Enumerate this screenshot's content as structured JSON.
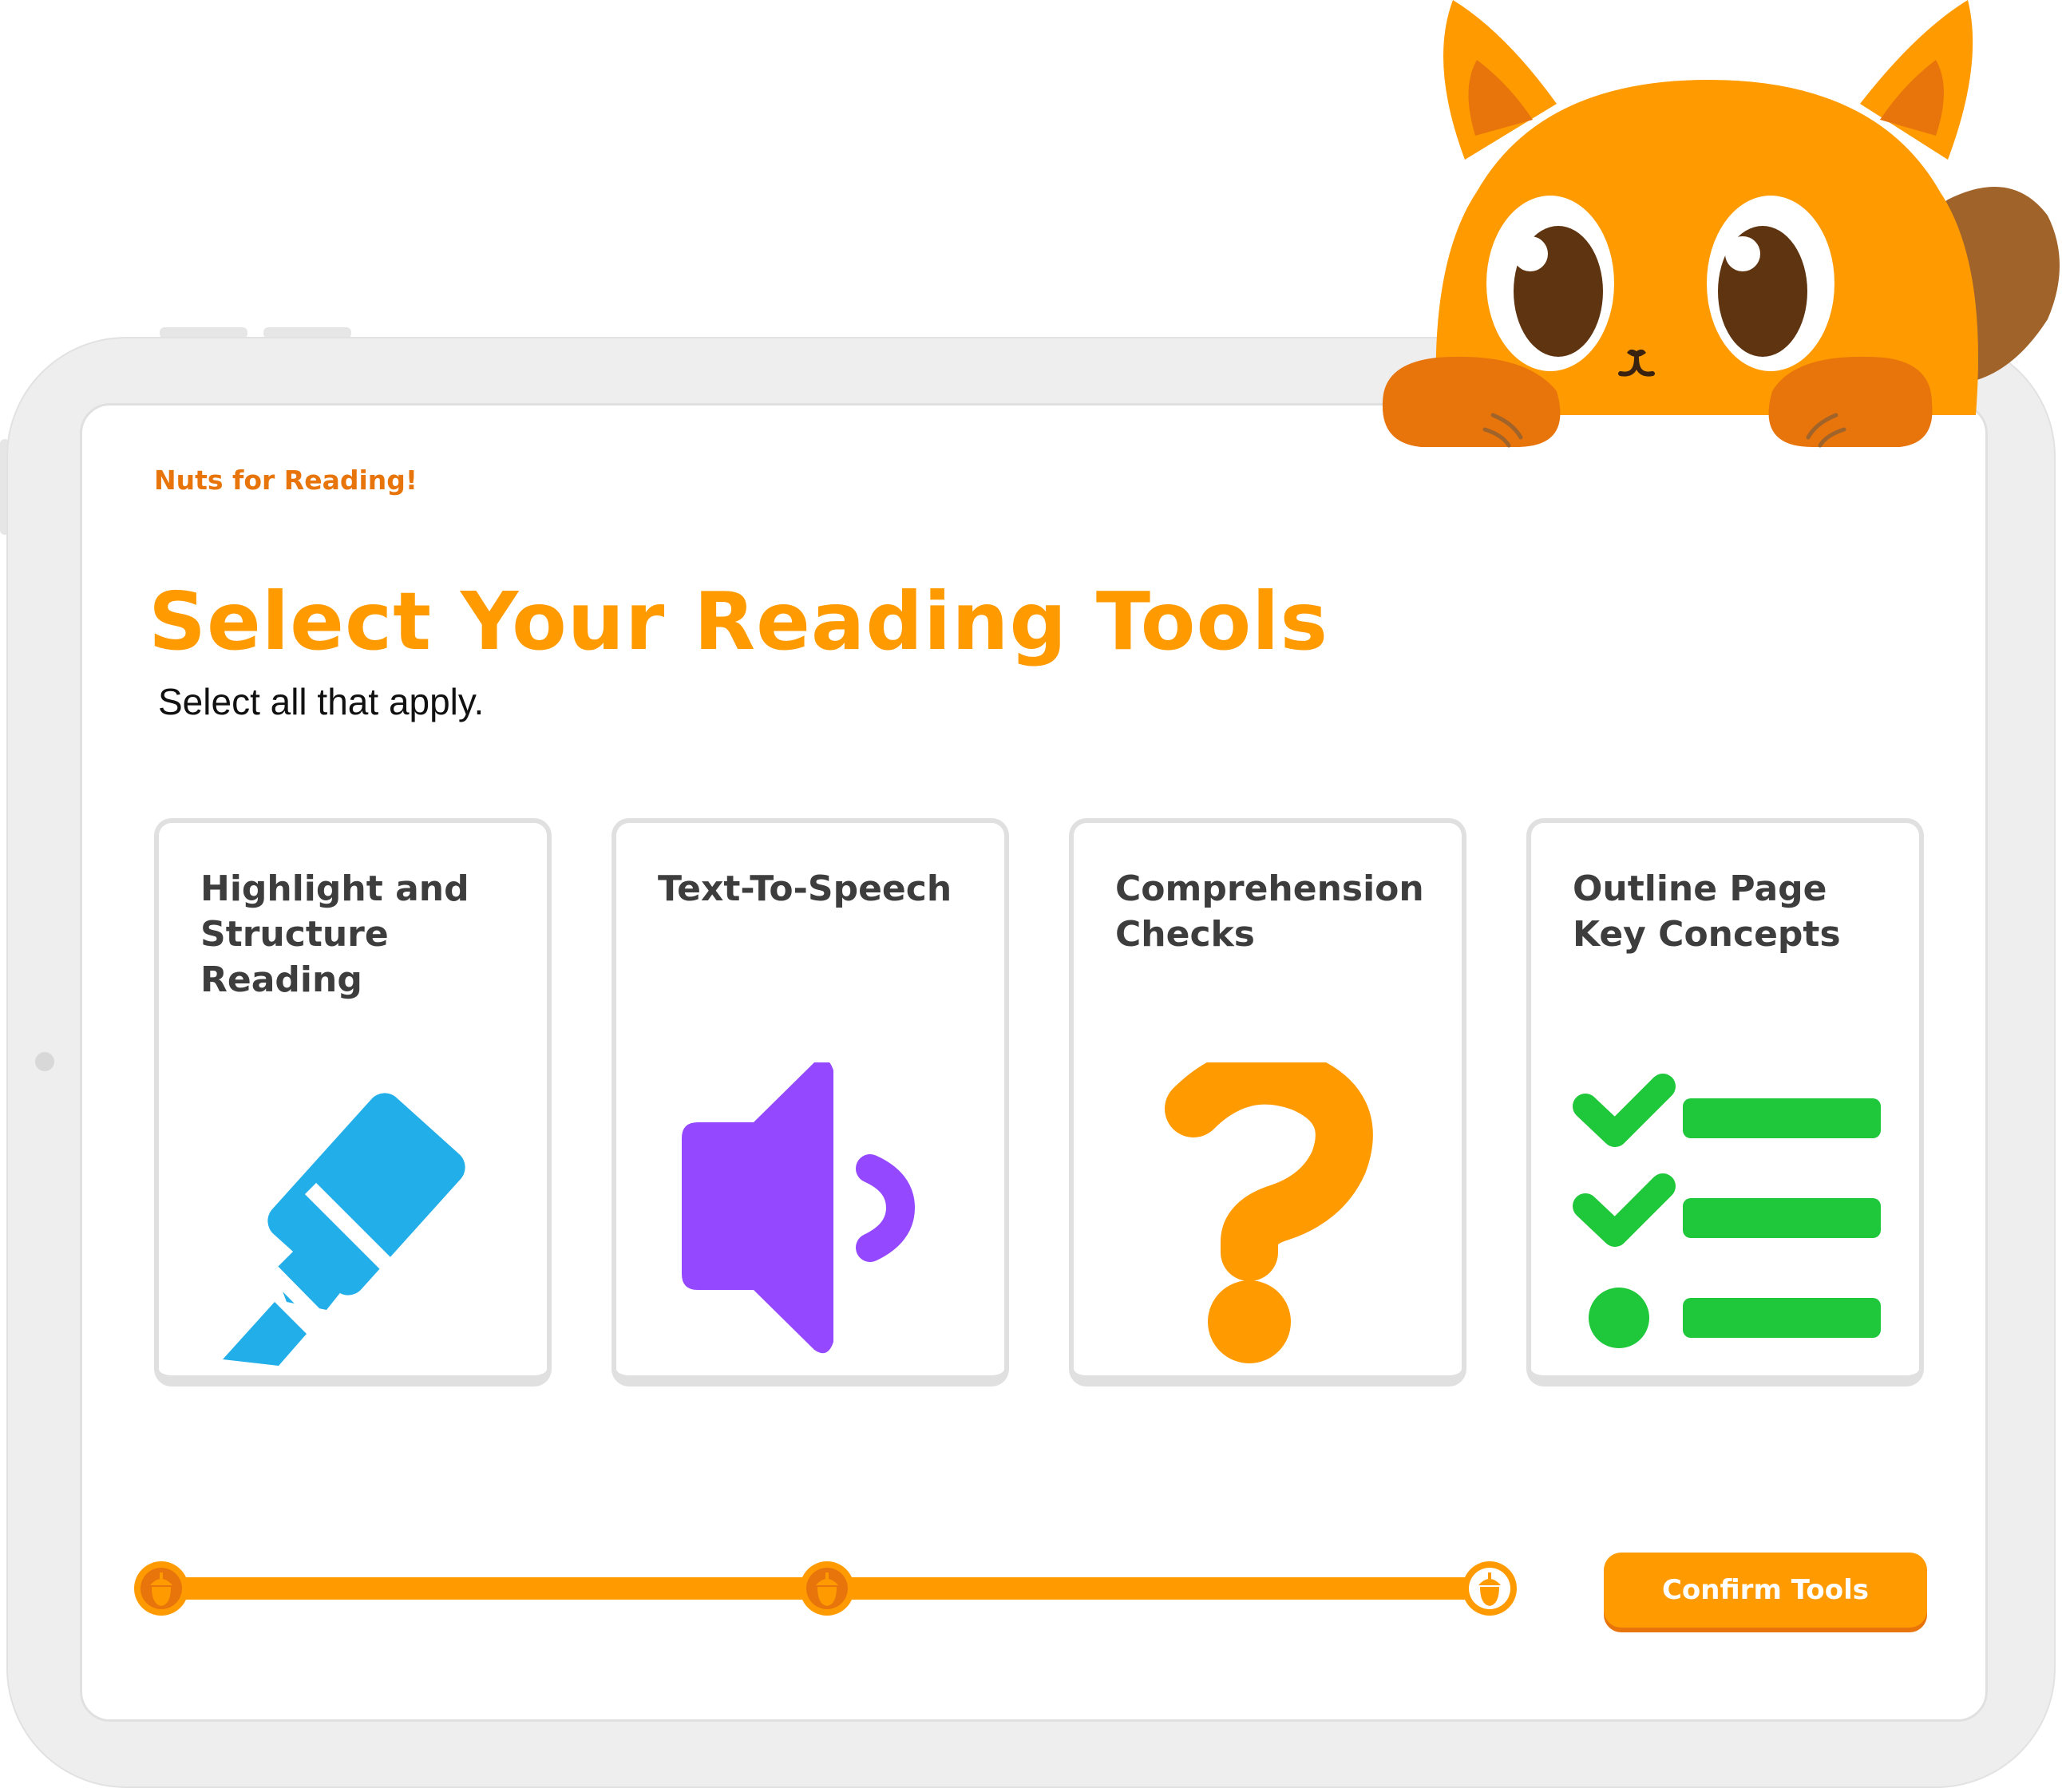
{
  "app": {
    "brand_label": "Nuts for Reading!"
  },
  "page": {
    "title": "Select Your Reading Tools",
    "subtitle": "Select all that apply."
  },
  "tools": [
    {
      "label": "Highlight and Structure Reading",
      "icon": "highlighter-icon",
      "color": "#22aee8"
    },
    {
      "label": "Text-To-Speech",
      "icon": "speaker-icon",
      "color": "#9448ff"
    },
    {
      "label": "Comprehension Checks",
      "icon": "question-mark-icon",
      "color": "#ff9b00"
    },
    {
      "label": "Outline Page Key Concepts",
      "icon": "checklist-icon",
      "color": "#1fc73a"
    }
  ],
  "progress": {
    "steps_total": 3,
    "steps_completed": 2,
    "step_icon": "acorn-icon"
  },
  "actions": {
    "confirm_label": "Confirm Tools"
  },
  "mascot": {
    "icon": "squirrel-mascot"
  },
  "colors": {
    "accent": "#ff9b00",
    "accent_dark": "#e8750b",
    "card_border": "#e0e0e0",
    "text_dark": "#3d3d3d"
  }
}
